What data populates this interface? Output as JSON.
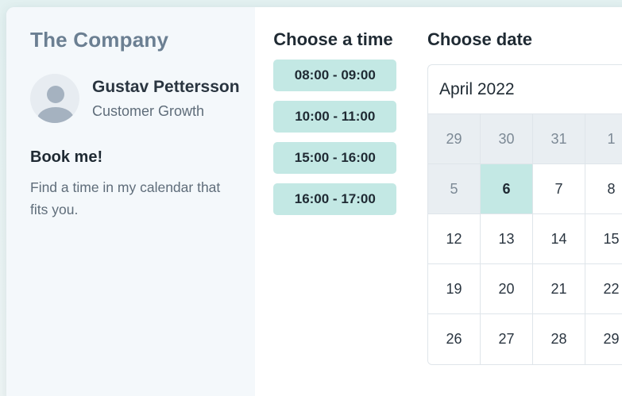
{
  "sidebar": {
    "company": "The Company",
    "person_name": "Gustav Pettersson",
    "person_role": "Customer Growth",
    "book_title": "Book me!",
    "book_description": "Find a time in my calendar that fits you."
  },
  "times": {
    "title": "Choose a time",
    "slots": [
      "08:00 - 09:00",
      "10:00 - 11:00",
      "15:00 - 16:00",
      "16:00 - 17:00"
    ]
  },
  "dates": {
    "title": "Choose date",
    "month": "April 2022",
    "weeks": [
      [
        {
          "d": "29",
          "muted": true
        },
        {
          "d": "30",
          "muted": true
        },
        {
          "d": "31",
          "muted": true
        },
        {
          "d": "1",
          "muted": true
        }
      ],
      [
        {
          "d": "5",
          "muted": true
        },
        {
          "d": "6",
          "selected": true
        },
        {
          "d": "7"
        },
        {
          "d": "8"
        }
      ],
      [
        {
          "d": "12"
        },
        {
          "d": "13"
        },
        {
          "d": "14"
        },
        {
          "d": "15"
        }
      ],
      [
        {
          "d": "19"
        },
        {
          "d": "20"
        },
        {
          "d": "21"
        },
        {
          "d": "22"
        }
      ],
      [
        {
          "d": "26"
        },
        {
          "d": "27"
        },
        {
          "d": "28"
        },
        {
          "d": "29"
        }
      ]
    ]
  },
  "colors": {
    "accent": "#c3e8e4",
    "sidebar_bg": "#f4f8fb",
    "muted_cell": "#e9eef2"
  }
}
